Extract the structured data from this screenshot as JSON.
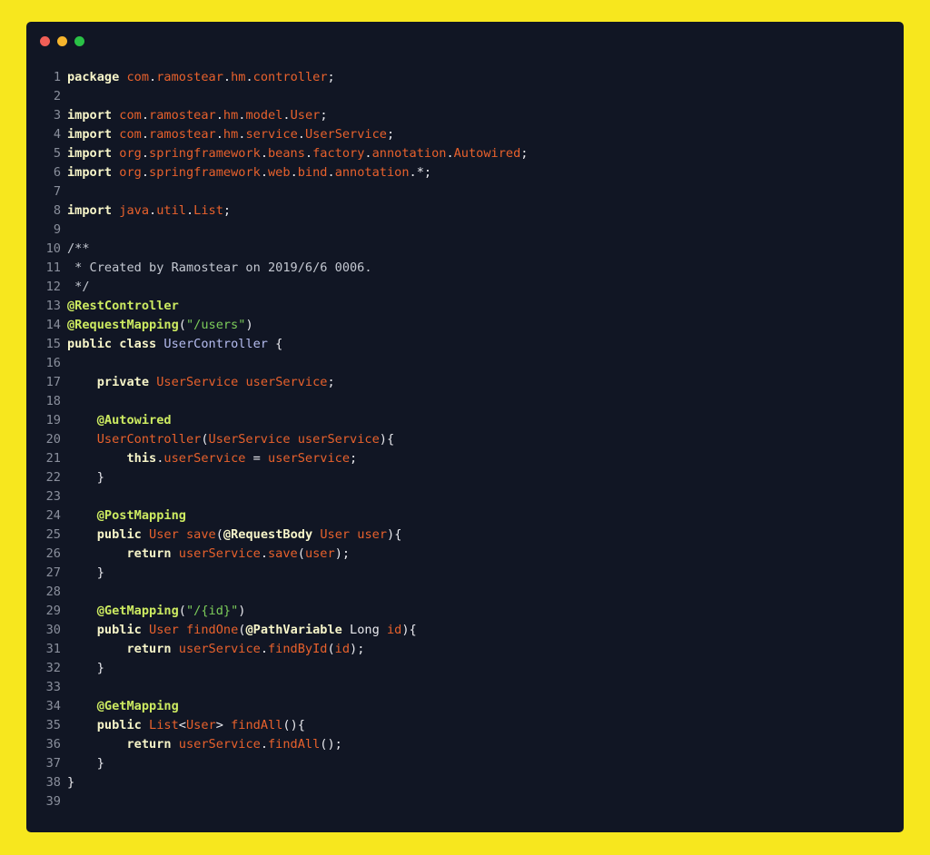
{
  "window": {
    "controls": [
      {
        "name": "close",
        "color": "#f15f57"
      },
      {
        "name": "minimize",
        "color": "#f6b52d"
      },
      {
        "name": "maximize",
        "color": "#2ac146"
      }
    ]
  },
  "code": {
    "lines": [
      {
        "n": "1",
        "tokens": [
          {
            "t": "package",
            "c": "kw"
          },
          {
            "t": " ",
            "c": "pl"
          },
          {
            "t": "com",
            "c": "id"
          },
          {
            "t": ".",
            "c": "pl"
          },
          {
            "t": "ramostear",
            "c": "id"
          },
          {
            "t": ".",
            "c": "pl"
          },
          {
            "t": "hm",
            "c": "id"
          },
          {
            "t": ".",
            "c": "pl"
          },
          {
            "t": "controller",
            "c": "id"
          },
          {
            "t": ";",
            "c": "pl"
          }
        ]
      },
      {
        "n": "2",
        "tokens": []
      },
      {
        "n": "3",
        "tokens": [
          {
            "t": "import",
            "c": "kw"
          },
          {
            "t": " ",
            "c": "pl"
          },
          {
            "t": "com",
            "c": "id"
          },
          {
            "t": ".",
            "c": "pl"
          },
          {
            "t": "ramostear",
            "c": "id"
          },
          {
            "t": ".",
            "c": "pl"
          },
          {
            "t": "hm",
            "c": "id"
          },
          {
            "t": ".",
            "c": "pl"
          },
          {
            "t": "model",
            "c": "id"
          },
          {
            "t": ".",
            "c": "pl"
          },
          {
            "t": "User",
            "c": "id"
          },
          {
            "t": ";",
            "c": "pl"
          }
        ]
      },
      {
        "n": "4",
        "tokens": [
          {
            "t": "import",
            "c": "kw"
          },
          {
            "t": " ",
            "c": "pl"
          },
          {
            "t": "com",
            "c": "id"
          },
          {
            "t": ".",
            "c": "pl"
          },
          {
            "t": "ramostear",
            "c": "id"
          },
          {
            "t": ".",
            "c": "pl"
          },
          {
            "t": "hm",
            "c": "id"
          },
          {
            "t": ".",
            "c": "pl"
          },
          {
            "t": "service",
            "c": "id"
          },
          {
            "t": ".",
            "c": "pl"
          },
          {
            "t": "UserService",
            "c": "id"
          },
          {
            "t": ";",
            "c": "pl"
          }
        ]
      },
      {
        "n": "5",
        "tokens": [
          {
            "t": "import",
            "c": "kw"
          },
          {
            "t": " ",
            "c": "pl"
          },
          {
            "t": "org",
            "c": "id"
          },
          {
            "t": ".",
            "c": "pl"
          },
          {
            "t": "springframework",
            "c": "id"
          },
          {
            "t": ".",
            "c": "pl"
          },
          {
            "t": "beans",
            "c": "id"
          },
          {
            "t": ".",
            "c": "pl"
          },
          {
            "t": "factory",
            "c": "id"
          },
          {
            "t": ".",
            "c": "pl"
          },
          {
            "t": "annotation",
            "c": "id"
          },
          {
            "t": ".",
            "c": "pl"
          },
          {
            "t": "Autowired",
            "c": "id"
          },
          {
            "t": ";",
            "c": "pl"
          }
        ]
      },
      {
        "n": "6",
        "tokens": [
          {
            "t": "import",
            "c": "kw"
          },
          {
            "t": " ",
            "c": "pl"
          },
          {
            "t": "org",
            "c": "id"
          },
          {
            "t": ".",
            "c": "pl"
          },
          {
            "t": "springframework",
            "c": "id"
          },
          {
            "t": ".",
            "c": "pl"
          },
          {
            "t": "web",
            "c": "id"
          },
          {
            "t": ".",
            "c": "pl"
          },
          {
            "t": "bind",
            "c": "id"
          },
          {
            "t": ".",
            "c": "pl"
          },
          {
            "t": "annotation",
            "c": "id"
          },
          {
            "t": ".*;",
            "c": "pl"
          }
        ]
      },
      {
        "n": "7",
        "tokens": []
      },
      {
        "n": "8",
        "tokens": [
          {
            "t": "import",
            "c": "kw"
          },
          {
            "t": " ",
            "c": "pl"
          },
          {
            "t": "java",
            "c": "id"
          },
          {
            "t": ".",
            "c": "pl"
          },
          {
            "t": "util",
            "c": "id"
          },
          {
            "t": ".",
            "c": "pl"
          },
          {
            "t": "List",
            "c": "id"
          },
          {
            "t": ";",
            "c": "pl"
          }
        ]
      },
      {
        "n": "9",
        "tokens": []
      },
      {
        "n": "10",
        "tokens": [
          {
            "t": "/**",
            "c": "cm"
          }
        ]
      },
      {
        "n": "11",
        "tokens": [
          {
            "t": " * Created by Ramostear on 2019/6/6 0006.",
            "c": "cm"
          }
        ]
      },
      {
        "n": "12",
        "tokens": [
          {
            "t": " */",
            "c": "cm"
          }
        ]
      },
      {
        "n": "13",
        "tokens": [
          {
            "t": "@RestController",
            "c": "an"
          }
        ]
      },
      {
        "n": "14",
        "tokens": [
          {
            "t": "@RequestMapping",
            "c": "an"
          },
          {
            "t": "(",
            "c": "pl"
          },
          {
            "t": "\"/users\"",
            "c": "st"
          },
          {
            "t": ")",
            "c": "pl"
          }
        ]
      },
      {
        "n": "15",
        "tokens": [
          {
            "t": "public",
            "c": "kw"
          },
          {
            "t": " ",
            "c": "pl"
          },
          {
            "t": "class",
            "c": "kw"
          },
          {
            "t": " ",
            "c": "pl"
          },
          {
            "t": "UserController",
            "c": "ty"
          },
          {
            "t": " {",
            "c": "pl"
          }
        ]
      },
      {
        "n": "16",
        "tokens": []
      },
      {
        "n": "17",
        "tokens": [
          {
            "t": "    ",
            "c": "pl"
          },
          {
            "t": "private",
            "c": "kw"
          },
          {
            "t": " ",
            "c": "pl"
          },
          {
            "t": "UserService",
            "c": "id"
          },
          {
            "t": " ",
            "c": "pl"
          },
          {
            "t": "userService",
            "c": "id"
          },
          {
            "t": ";",
            "c": "pl"
          }
        ]
      },
      {
        "n": "18",
        "tokens": []
      },
      {
        "n": "19",
        "tokens": [
          {
            "t": "    ",
            "c": "pl"
          },
          {
            "t": "@Autowired",
            "c": "an"
          }
        ]
      },
      {
        "n": "20",
        "tokens": [
          {
            "t": "    ",
            "c": "pl"
          },
          {
            "t": "UserController",
            "c": "id"
          },
          {
            "t": "(",
            "c": "pl"
          },
          {
            "t": "UserService",
            "c": "id"
          },
          {
            "t": " ",
            "c": "pl"
          },
          {
            "t": "userService",
            "c": "id"
          },
          {
            "t": "){",
            "c": "pl"
          }
        ]
      },
      {
        "n": "21",
        "tokens": [
          {
            "t": "        ",
            "c": "pl"
          },
          {
            "t": "this",
            "c": "kw"
          },
          {
            "t": ".",
            "c": "pl"
          },
          {
            "t": "userService",
            "c": "id"
          },
          {
            "t": " = ",
            "c": "pl"
          },
          {
            "t": "userService",
            "c": "id"
          },
          {
            "t": ";",
            "c": "pl"
          }
        ]
      },
      {
        "n": "22",
        "tokens": [
          {
            "t": "    }",
            "c": "pl"
          }
        ]
      },
      {
        "n": "23",
        "tokens": []
      },
      {
        "n": "24",
        "tokens": [
          {
            "t": "    ",
            "c": "pl"
          },
          {
            "t": "@PostMapping",
            "c": "an"
          }
        ]
      },
      {
        "n": "25",
        "tokens": [
          {
            "t": "    ",
            "c": "pl"
          },
          {
            "t": "public",
            "c": "kw"
          },
          {
            "t": " ",
            "c": "pl"
          },
          {
            "t": "User",
            "c": "id"
          },
          {
            "t": " ",
            "c": "pl"
          },
          {
            "t": "save",
            "c": "id"
          },
          {
            "t": "(",
            "c": "pl"
          },
          {
            "t": "@RequestBody",
            "c": "kw"
          },
          {
            "t": " ",
            "c": "pl"
          },
          {
            "t": "User",
            "c": "id"
          },
          {
            "t": " ",
            "c": "pl"
          },
          {
            "t": "user",
            "c": "id"
          },
          {
            "t": "){",
            "c": "pl"
          }
        ]
      },
      {
        "n": "26",
        "tokens": [
          {
            "t": "        ",
            "c": "pl"
          },
          {
            "t": "return",
            "c": "kw"
          },
          {
            "t": " ",
            "c": "pl"
          },
          {
            "t": "userService",
            "c": "id"
          },
          {
            "t": ".",
            "c": "pl"
          },
          {
            "t": "save",
            "c": "id"
          },
          {
            "t": "(",
            "c": "pl"
          },
          {
            "t": "user",
            "c": "id"
          },
          {
            "t": ");",
            "c": "pl"
          }
        ]
      },
      {
        "n": "27",
        "tokens": [
          {
            "t": "    }",
            "c": "pl"
          }
        ]
      },
      {
        "n": "28",
        "tokens": []
      },
      {
        "n": "29",
        "tokens": [
          {
            "t": "    ",
            "c": "pl"
          },
          {
            "t": "@GetMapping",
            "c": "an"
          },
          {
            "t": "(",
            "c": "pl"
          },
          {
            "t": "\"/{id}\"",
            "c": "st"
          },
          {
            "t": ")",
            "c": "pl"
          }
        ]
      },
      {
        "n": "30",
        "tokens": [
          {
            "t": "    ",
            "c": "pl"
          },
          {
            "t": "public",
            "c": "kw"
          },
          {
            "t": " ",
            "c": "pl"
          },
          {
            "t": "User",
            "c": "id"
          },
          {
            "t": " ",
            "c": "pl"
          },
          {
            "t": "findOne",
            "c": "id"
          },
          {
            "t": "(",
            "c": "pl"
          },
          {
            "t": "@PathVariable",
            "c": "kw"
          },
          {
            "t": " Long ",
            "c": "pl"
          },
          {
            "t": "id",
            "c": "id"
          },
          {
            "t": "){",
            "c": "pl"
          }
        ]
      },
      {
        "n": "31",
        "tokens": [
          {
            "t": "        ",
            "c": "pl"
          },
          {
            "t": "return",
            "c": "kw"
          },
          {
            "t": " ",
            "c": "pl"
          },
          {
            "t": "userService",
            "c": "id"
          },
          {
            "t": ".",
            "c": "pl"
          },
          {
            "t": "findById",
            "c": "id"
          },
          {
            "t": "(",
            "c": "pl"
          },
          {
            "t": "id",
            "c": "id"
          },
          {
            "t": ");",
            "c": "pl"
          }
        ]
      },
      {
        "n": "32",
        "tokens": [
          {
            "t": "    }",
            "c": "pl"
          }
        ]
      },
      {
        "n": "33",
        "tokens": []
      },
      {
        "n": "34",
        "tokens": [
          {
            "t": "    ",
            "c": "pl"
          },
          {
            "t": "@GetMapping",
            "c": "an"
          }
        ]
      },
      {
        "n": "35",
        "tokens": [
          {
            "t": "    ",
            "c": "pl"
          },
          {
            "t": "public",
            "c": "kw"
          },
          {
            "t": " ",
            "c": "pl"
          },
          {
            "t": "List",
            "c": "id"
          },
          {
            "t": "<",
            "c": "pl"
          },
          {
            "t": "User",
            "c": "id"
          },
          {
            "t": "> ",
            "c": "pl"
          },
          {
            "t": "findAll",
            "c": "id"
          },
          {
            "t": "(){",
            "c": "pl"
          }
        ]
      },
      {
        "n": "36",
        "tokens": [
          {
            "t": "        ",
            "c": "pl"
          },
          {
            "t": "return",
            "c": "kw"
          },
          {
            "t": " ",
            "c": "pl"
          },
          {
            "t": "userService",
            "c": "id"
          },
          {
            "t": ".",
            "c": "pl"
          },
          {
            "t": "findAll",
            "c": "id"
          },
          {
            "t": "();",
            "c": "pl"
          }
        ]
      },
      {
        "n": "37",
        "tokens": [
          {
            "t": "    }",
            "c": "pl"
          }
        ]
      },
      {
        "n": "38",
        "tokens": [
          {
            "t": "}",
            "c": "pl"
          }
        ]
      },
      {
        "n": "39",
        "tokens": []
      }
    ]
  }
}
